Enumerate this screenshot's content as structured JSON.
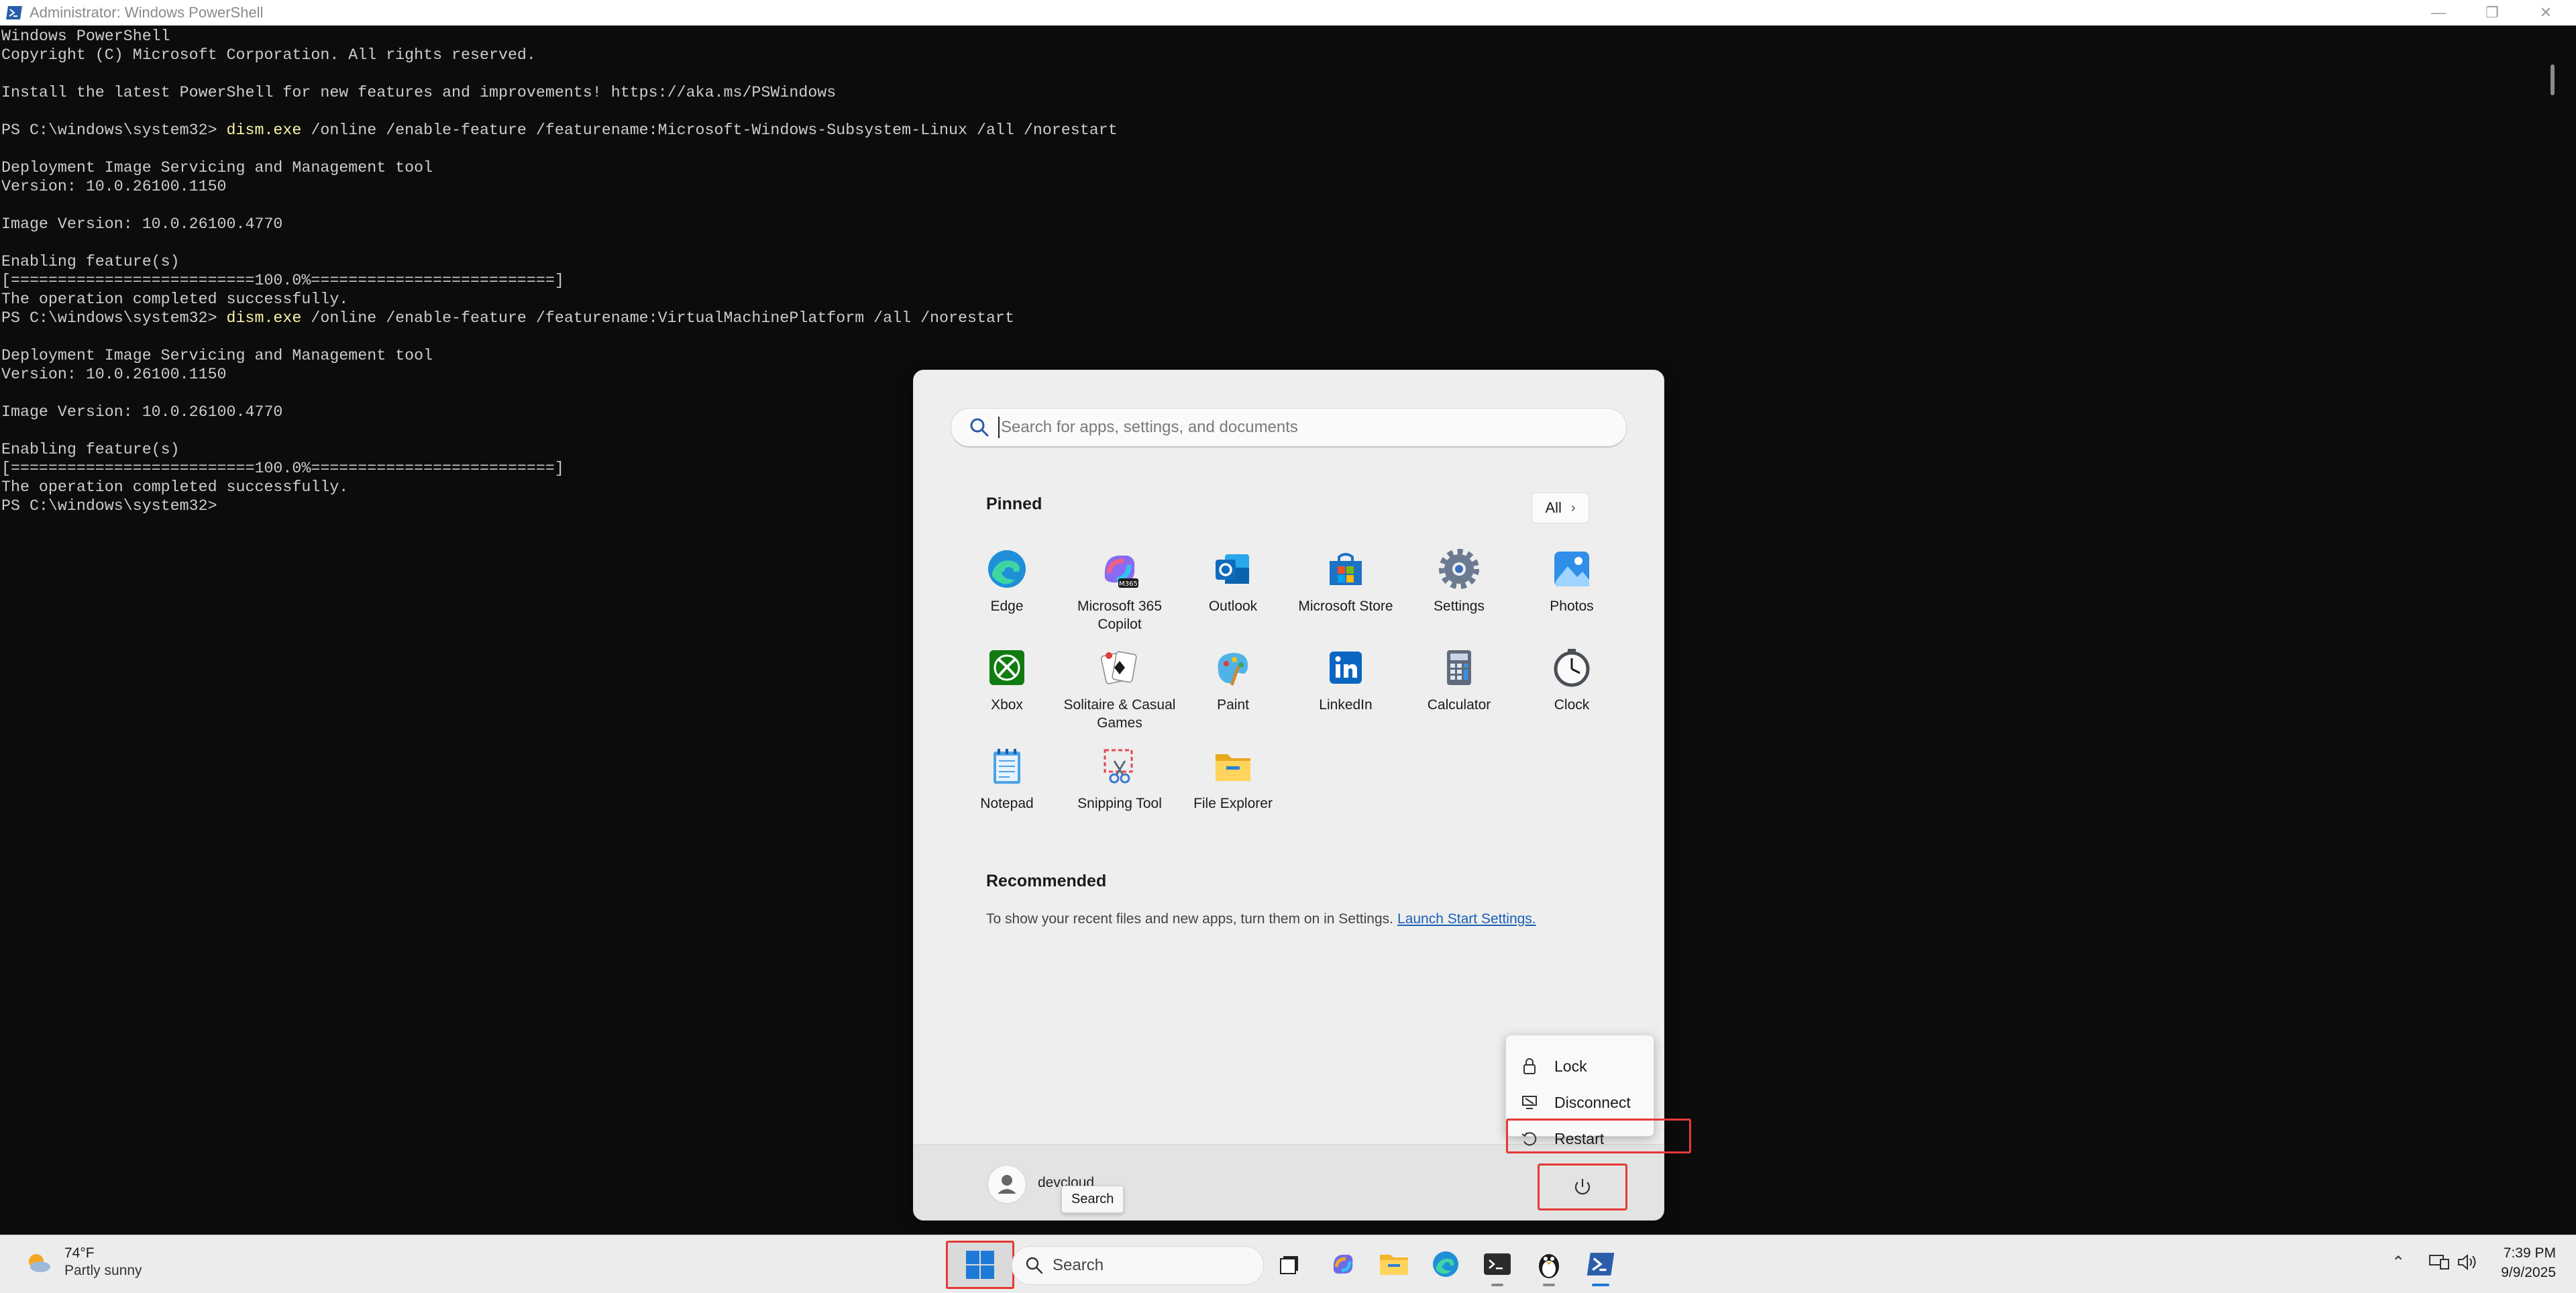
{
  "window": {
    "title": "Administrator: Windows PowerShell",
    "controls": [
      "minimize",
      "restore",
      "close"
    ]
  },
  "terminal": {
    "lines": [
      {
        "prompt": "",
        "text": "Windows PowerShell"
      },
      {
        "prompt": "",
        "text": "Copyright (C) Microsoft Corporation. All rights reserved."
      },
      {
        "prompt": "",
        "text": ""
      },
      {
        "prompt": "",
        "text": "Install the latest PowerShell for new features and improvements! https://aka.ms/PSWindows"
      },
      {
        "prompt": "",
        "text": ""
      },
      {
        "prompt": "PS C:\\windows\\system32> ",
        "cmd": "dism.exe",
        "text": " /online /enable-feature /featurename:Microsoft-Windows-Subsystem-Linux /all /norestart"
      },
      {
        "prompt": "",
        "text": ""
      },
      {
        "prompt": "",
        "text": "Deployment Image Servicing and Management tool"
      },
      {
        "prompt": "",
        "text": "Version: 10.0.26100.1150"
      },
      {
        "prompt": "",
        "text": ""
      },
      {
        "prompt": "",
        "text": "Image Version: 10.0.26100.4770"
      },
      {
        "prompt": "",
        "text": ""
      },
      {
        "prompt": "",
        "text": "Enabling feature(s)"
      },
      {
        "prompt": "",
        "text": "[==========================100.0%==========================]"
      },
      {
        "prompt": "",
        "text": "The operation completed successfully."
      },
      {
        "prompt": "PS C:\\windows\\system32> ",
        "cmd": "dism.exe",
        "text": " /online /enable-feature /featurename:VirtualMachinePlatform /all /norestart"
      },
      {
        "prompt": "",
        "text": ""
      },
      {
        "prompt": "",
        "text": "Deployment Image Servicing and Management tool"
      },
      {
        "prompt": "",
        "text": "Version: 10.0.26100.1150"
      },
      {
        "prompt": "",
        "text": ""
      },
      {
        "prompt": "",
        "text": "Image Version: 10.0.26100.4770"
      },
      {
        "prompt": "",
        "text": ""
      },
      {
        "prompt": "",
        "text": "Enabling feature(s)"
      },
      {
        "prompt": "",
        "text": "[==========================100.0%==========================]"
      },
      {
        "prompt": "",
        "text": "The operation completed successfully."
      },
      {
        "prompt": "PS C:\\windows\\system32> ",
        "text": ""
      }
    ]
  },
  "start_menu": {
    "search_placeholder": "Search for apps, settings, and documents",
    "pinned_title": "Pinned",
    "all_label": "All",
    "apps": [
      {
        "label": "Edge",
        "icon": "edge-icon"
      },
      {
        "label": "Microsoft 365 Copilot",
        "icon": "m365-copilot-icon"
      },
      {
        "label": "Outlook",
        "icon": "outlook-icon"
      },
      {
        "label": "Microsoft Store",
        "icon": "store-icon"
      },
      {
        "label": "Settings",
        "icon": "settings-icon"
      },
      {
        "label": "Photos",
        "icon": "photos-icon"
      },
      {
        "label": "Xbox",
        "icon": "xbox-icon"
      },
      {
        "label": "Solitaire & Casual Games",
        "icon": "solitaire-icon"
      },
      {
        "label": "Paint",
        "icon": "paint-icon"
      },
      {
        "label": "LinkedIn",
        "icon": "linkedin-icon"
      },
      {
        "label": "Calculator",
        "icon": "calculator-icon"
      },
      {
        "label": "Clock",
        "icon": "clock-icon"
      },
      {
        "label": "Notepad",
        "icon": "notepad-icon"
      },
      {
        "label": "Snipping Tool",
        "icon": "snipping-tool-icon"
      },
      {
        "label": "File Explorer",
        "icon": "file-explorer-icon"
      }
    ],
    "recommended_title": "Recommended",
    "recommended_text": "To show your recent files and new apps, turn them on in Settings.",
    "recommended_link": "Launch Start Settings.",
    "user_name": "devcloud",
    "tooltip": "Search",
    "power_menu": [
      {
        "label": "Lock",
        "icon": "lock-icon"
      },
      {
        "label": "Disconnect",
        "icon": "disconnect-icon"
      },
      {
        "label": "Restart",
        "icon": "restart-icon"
      }
    ]
  },
  "taskbar": {
    "weather_temp": "74°F",
    "weather_cond": "Partly sunny",
    "search_label": "Search",
    "time": "7:39 PM",
    "date": "9/9/2025"
  },
  "colors": {
    "highlight": "#e53935",
    "terminal_bg": "#0c0c0c",
    "terminal_text": "#cccccc",
    "command_text": "#f9f1a5",
    "link": "#1a5fb4"
  }
}
